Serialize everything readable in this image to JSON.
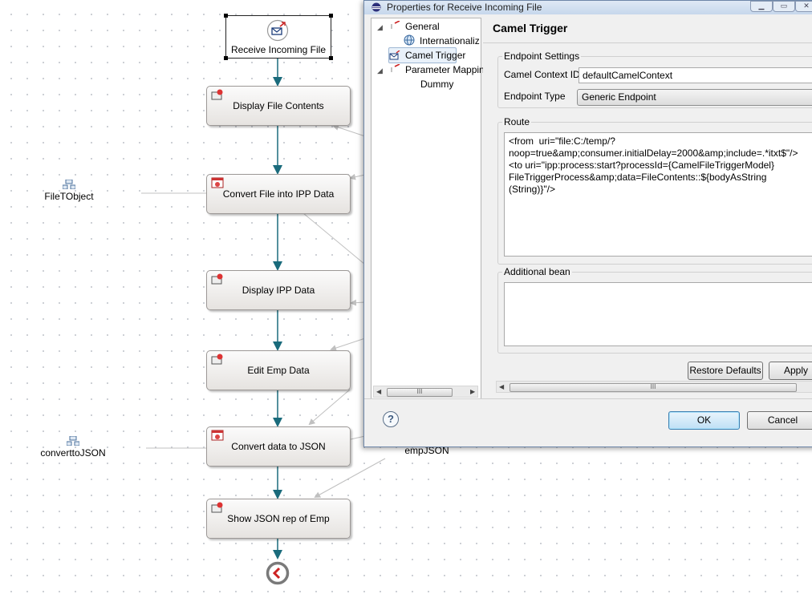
{
  "diagram": {
    "start_node": {
      "label": "Receive Incoming File"
    },
    "activities": [
      {
        "label": "Display File Contents"
      },
      {
        "label": "Convert File into IPP Data"
      },
      {
        "label": "Display IPP Data"
      },
      {
        "label": "Edit Emp Data"
      },
      {
        "label": "Convert data to JSON"
      },
      {
        "label": "Show JSON rep of Emp"
      }
    ],
    "data_nodes": [
      {
        "label": "FileTObject"
      },
      {
        "label": "converttoJSON"
      },
      {
        "label": "empJSON"
      }
    ],
    "colors": {
      "flow": "#1a6b7c",
      "data_flow": "#c0c0c0",
      "end": "#7a7a7a"
    }
  },
  "dialog": {
    "title": "Properties for Receive Incoming File",
    "window_buttons": [
      "minimize-icon",
      "maximize-icon",
      "close-icon"
    ],
    "tree": {
      "items": [
        {
          "label": "General"
        },
        {
          "label": "Internationaliz"
        },
        {
          "label": "Camel Trigger"
        },
        {
          "label": "Parameter Mappin"
        },
        {
          "label": "Dummy"
        }
      ],
      "scroll_thumb": "III"
    },
    "page_title": "Camel Trigger",
    "endpoint_settings": {
      "legend": "Endpoint Settings",
      "context_id_label": "Camel Context ID",
      "context_id_value": "defaultCamelContext",
      "endpoint_type_label": "Endpoint Type",
      "endpoint_type_value": "Generic Endpoint"
    },
    "route": {
      "legend": "Route",
      "text": "<from  uri=\"file:C:/temp/?\nnoop=true&amp;consumer.initialDelay=2000&amp;include=.*itxt$\"/>\n<to uri=\"ipp:process:start?processId={CamelFileTriggerModel}\nFileTriggerProcess&amp;data=FileContents::${bodyAsString\n(String)}\"/>"
    },
    "additional_bean": {
      "legend": "Additional bean",
      "text": ""
    },
    "restore_defaults_label": "Restore Defaults",
    "apply_label": "Apply",
    "scroll_thumb": "III",
    "ok_label": "OK",
    "cancel_label": "Cancel",
    "help_icon": "?"
  }
}
